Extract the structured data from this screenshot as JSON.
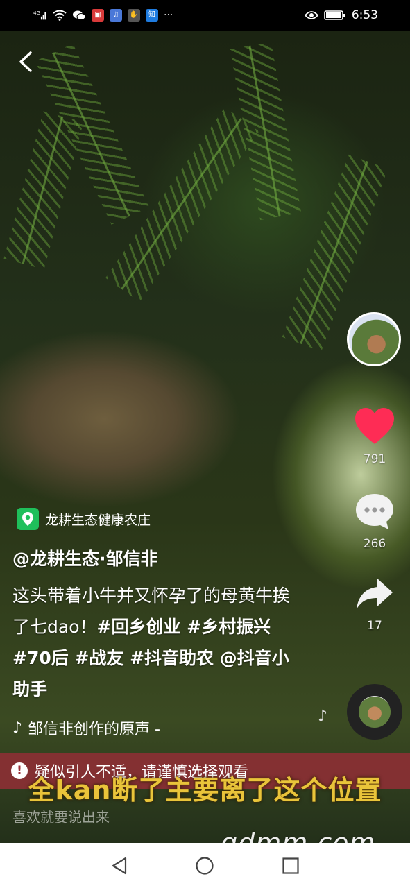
{
  "status_bar": {
    "signal": "4G",
    "time": "6:53",
    "icons": [
      "signal-icon",
      "wifi-icon",
      "wechat-icon",
      "app-red-icon",
      "music-app-icon",
      "hand-icon",
      "zhihu-icon",
      "more-icon",
      "eye-icon",
      "battery-icon"
    ],
    "zhihu_label": "知",
    "more_label": "···"
  },
  "video": {
    "location": "龙耕生态健康农庄",
    "author": "@龙耕生态·邹信非",
    "description_plain": "这头带着小牛并又怀孕了的母黄牛挨了七dao！",
    "hashtags": "#回乡创业 #乡村振兴 #70后 #战友 #抖音助农 @抖音小助手",
    "music": "邹信非创作的原声 -",
    "subtitle": "全kan断了主要离了这个位置"
  },
  "actions": {
    "likes": "791",
    "comments": "266",
    "shares": "17"
  },
  "warning": "疑似引人不适，请谨慎选择观看",
  "comment_placeholder": "喜欢就要说出来",
  "watermark": "gdmm.com",
  "colors": {
    "like": "#fe2c55",
    "location_badge": "#1fbf5b",
    "warning_bg": "#962d37",
    "subtitle": "#e9c43a"
  }
}
